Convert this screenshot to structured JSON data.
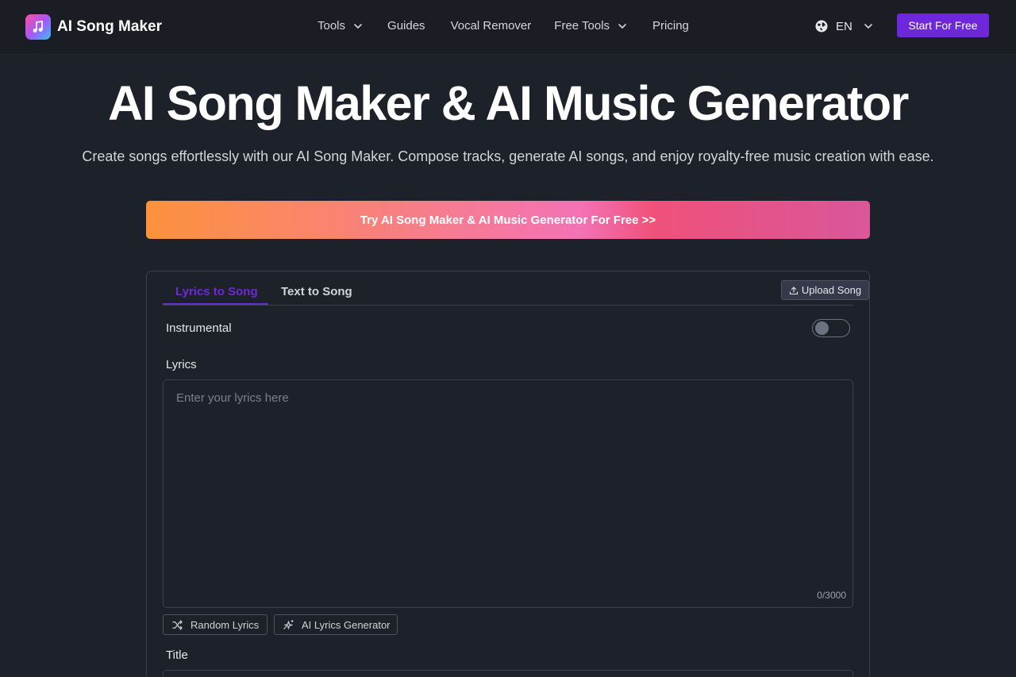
{
  "header": {
    "brand": "AI Song Maker",
    "nav": [
      {
        "label": "Tools",
        "has_dropdown": true
      },
      {
        "label": "Guides",
        "has_dropdown": false
      },
      {
        "label": "Vocal Remover",
        "has_dropdown": false
      },
      {
        "label": "Free Tools",
        "has_dropdown": true
      },
      {
        "label": "Pricing",
        "has_dropdown": false
      }
    ],
    "language": "EN",
    "start_button": "Start For Free"
  },
  "hero": {
    "title": "AI Song Maker & AI Music Generator",
    "subtitle": "Create songs effortlessly with our AI Song Maker. Compose tracks, generate AI songs, and enjoy royalty-free music creation with ease.",
    "cta": "Try AI Song Maker & AI Music Generator For Free >>"
  },
  "form": {
    "tabs": [
      {
        "label": "Lyrics to Song",
        "active": true
      },
      {
        "label": "Text to Song",
        "active": false
      }
    ],
    "upload_button": "Upload Song",
    "instrumental_label": "Instrumental",
    "instrumental_on": false,
    "lyrics_label": "Lyrics",
    "lyrics_placeholder": "Enter your lyrics here",
    "lyrics_value": "",
    "char_count": "0/3000",
    "random_lyrics_button": "Random Lyrics",
    "ai_lyrics_button": "AI Lyrics Generator",
    "title_label": "Title"
  },
  "colors": {
    "accent": "#6d28d9",
    "background": "#1d2129",
    "header_bg": "#1a1d24",
    "cta_gradient_start": "#fb923c",
    "cta_gradient_end": "#d9579a"
  },
  "icons": {
    "logo": "music-note-icon",
    "dropdown": "chevron-down-icon",
    "language": "globe-icon",
    "upload": "upload-icon",
    "random": "shuffle-icon",
    "ai": "sparkles-icon"
  }
}
